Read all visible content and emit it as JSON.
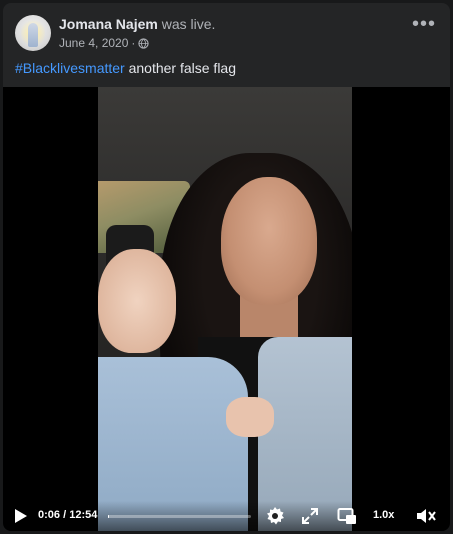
{
  "post": {
    "author": "Jomana Najem",
    "action": "was live.",
    "date": "June 4, 2020",
    "separator": "·",
    "privacy_icon": "globe-icon",
    "more_icon": "ellipsis-icon",
    "hashtag": "#Blacklivesmatter",
    "text": "another false flag"
  },
  "video": {
    "current_time": "0:06",
    "time_separator": " / ",
    "duration": "12:54",
    "progress_fraction": 0.008,
    "playback_speed": "1.0x",
    "icons": [
      "play-icon",
      "settings-icon",
      "fullscreen-icon",
      "picture-in-picture-icon",
      "volume-icon"
    ]
  },
  "colors": {
    "background": "#18191a",
    "card": "#242526",
    "text_primary": "#e4e6eb",
    "text_secondary": "#b0b3b8",
    "hashtag": "#4599ff"
  }
}
